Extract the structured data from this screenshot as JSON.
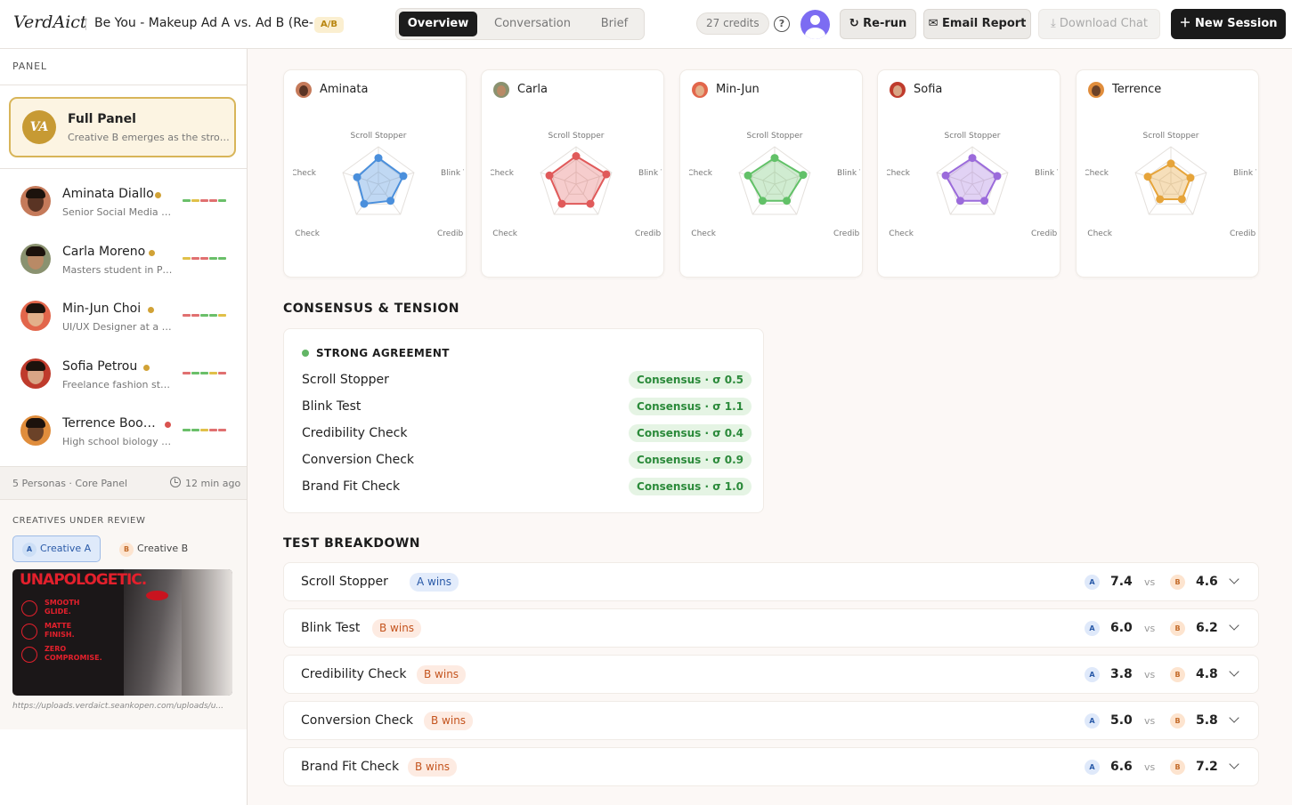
{
  "header": {
    "logo": "VerdAict",
    "title": "Be You - Makeup Ad A vs. Ad B (Re-...",
    "badge": "A/B",
    "tabs": [
      "Overview",
      "Conversation",
      "Brief"
    ],
    "active_tab": "Overview",
    "credits": "27 credits",
    "help_icon": "?",
    "rerun": "↻ Re-run",
    "email_report": "✉ Email Report",
    "download_chat": "⤓ Download Chat",
    "new_session": "＋ New Session"
  },
  "sidebar": {
    "label": "PANEL",
    "full_panel": {
      "initials": "VA",
      "title": "Full Panel",
      "subtitle": "Creative B emerges as the strong..."
    },
    "personas": [
      {
        "name": "Aminata Diallo",
        "role": "Senior Social Media Ma...",
        "status": "#d1a236",
        "skin": "#5a3424",
        "bg": "#c57a5a"
      },
      {
        "name": "Carla Moreno",
        "role": "Masters student in Pu...",
        "status": "#d1a236",
        "skin": "#b98a66",
        "bg": "#8a9270"
      },
      {
        "name": "Min-Jun Choi",
        "role": "UI/UX Designer at a mo...",
        "status": "#d1a236",
        "skin": "#e3b08a",
        "bg": "#e2664b"
      },
      {
        "name": "Sofia Petrou",
        "role": "Freelance fashion styli...",
        "status": "#d1a236",
        "skin": "#d9a585",
        "bg": "#bf3b2c"
      },
      {
        "name": "Terrence Book...",
        "role": "High school biology te...",
        "status": "#d9534f",
        "skin": "#6b4228",
        "bg": "#e08d3c"
      }
    ],
    "footer_left": "5 Personas · Core Panel",
    "footer_right": "12 min ago",
    "creatives_label": "CREATIVES UNDER REVIEW",
    "creative_a": "Creative A",
    "creative_b": "Creative B",
    "image_headline": "UNAPOLOGETIC.",
    "image_lines": [
      "SMOOTH GLIDE.",
      "MATTE FINISH.",
      "ZERO COMPROMISE."
    ],
    "image_url": "https://uploads.verdaict.seankopen.com/uploads/u..."
  },
  "radar": {
    "axes": [
      "Scroll Stopper",
      "Blink Test",
      "Credibility Che",
      "onversion Check",
      "d Fit Check"
    ],
    "personas": [
      {
        "name": "Aminata",
        "color": "#4a8fdc",
        "fill": "rgba(74,143,220,0.35)",
        "values": [
          7.0,
          7.0,
          5.5,
          6.5,
          6.0
        ]
      },
      {
        "name": "Carla",
        "color": "#e05a5a",
        "fill": "rgba(224,90,90,0.30)",
        "values": [
          7.5,
          8.5,
          6.5,
          6.5,
          7.5
        ]
      },
      {
        "name": "Min-Jun",
        "color": "#62c168",
        "fill": "rgba(98,193,104,0.30)",
        "values": [
          7.0,
          8.0,
          5.5,
          5.5,
          7.5
        ]
      },
      {
        "name": "Sofia",
        "color": "#9b6bdb",
        "fill": "rgba(155,107,219,0.30)",
        "values": [
          7.0,
          7.0,
          5.5,
          5.5,
          7.5
        ]
      },
      {
        "name": "Terrence",
        "color": "#e6a43a",
        "fill": "rgba(230,164,58,0.35)",
        "values": [
          5.5,
          5.5,
          5.0,
          5.0,
          6.5
        ]
      }
    ]
  },
  "consensus": {
    "title": "CONSENSUS & TENSION",
    "group_label": "STRONG AGREEMENT",
    "rows": [
      {
        "name": "Scroll Stopper",
        "pill": "Consensus · σ 0.5"
      },
      {
        "name": "Blink Test",
        "pill": "Consensus · σ 1.1"
      },
      {
        "name": "Credibility Check",
        "pill": "Consensus · σ 0.4"
      },
      {
        "name": "Conversion Check",
        "pill": "Consensus · σ 0.9"
      },
      {
        "name": "Brand Fit Check",
        "pill": "Consensus · σ 1.0"
      }
    ]
  },
  "tests": {
    "title": "TEST BREAKDOWN",
    "rows": [
      {
        "name": "Scroll Stopper",
        "winner": "A",
        "badge": "A wins",
        "a": "7.4",
        "b": "4.6"
      },
      {
        "name": "Blink Test",
        "winner": "B",
        "badge": "B wins",
        "a": "6.0",
        "b": "6.2"
      },
      {
        "name": "Credibility Check",
        "winner": "B",
        "badge": "B wins",
        "a": "3.8",
        "b": "4.8"
      },
      {
        "name": "Conversion Check",
        "winner": "B",
        "badge": "B wins",
        "a": "5.0",
        "b": "5.8"
      },
      {
        "name": "Brand Fit Check",
        "winner": "B",
        "badge": "B wins",
        "a": "6.6",
        "b": "7.2"
      }
    ],
    "vs": "vs",
    "chip_a": "A",
    "chip_b": "B"
  },
  "colors": {
    "bar_green": "#6abf69",
    "bar_yellow": "#e0c049",
    "bar_red": "#e07070"
  }
}
